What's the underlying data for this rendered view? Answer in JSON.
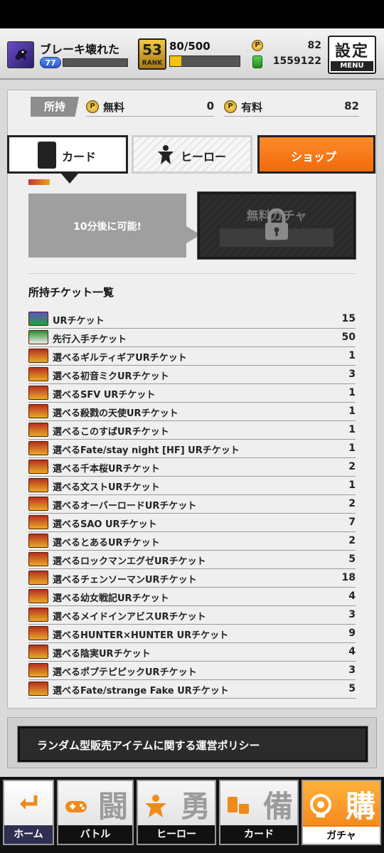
{
  "header": {
    "player_name": "ブレーキ壊れた",
    "level": "77",
    "rank": "53",
    "rank_label": "RANK",
    "stamina": "80/500",
    "stamina_ratio": 0.16,
    "paid_currency": "82",
    "money": "1559122",
    "settings_label": "設定",
    "menu_label": "MENU"
  },
  "owned": {
    "label": "所持",
    "free_label": "無料",
    "free_value": "0",
    "paid_label": "有料",
    "paid_value": "82"
  },
  "tabs": {
    "card": "カード",
    "hero": "ヒーロー",
    "shop": "ショップ"
  },
  "free_gacha": {
    "wait_text": "10分後に可能!",
    "title": "無料ガチャ",
    "button": "無料"
  },
  "tickets": {
    "title": "所持チケット一覧",
    "items": [
      {
        "name": "URチケット",
        "count": "15",
        "kind": "ur"
      },
      {
        "name": "先行入手チケット",
        "count": "50",
        "kind": "early"
      },
      {
        "name": "選べるギルティギアURチケット",
        "count": "1",
        "kind": "select"
      },
      {
        "name": "選べる初音ミクURチケット",
        "count": "3",
        "kind": "select"
      },
      {
        "name": "選べるSFV URチケット",
        "count": "1",
        "kind": "select"
      },
      {
        "name": "選べる殺戮の天使URチケット",
        "count": "1",
        "kind": "select"
      },
      {
        "name": "選べるこのすばURチケット",
        "count": "1",
        "kind": "select"
      },
      {
        "name": "選べるFate/stay night [HF] URチケット",
        "count": "1",
        "kind": "select"
      },
      {
        "name": "選べる千本桜URチケット",
        "count": "2",
        "kind": "select"
      },
      {
        "name": "選べる文ストURチケット",
        "count": "1",
        "kind": "select"
      },
      {
        "name": "選べるオーバーロードURチケット",
        "count": "2",
        "kind": "select"
      },
      {
        "name": "選べるSAO URチケット",
        "count": "7",
        "kind": "select"
      },
      {
        "name": "選べるとあるURチケット",
        "count": "2",
        "kind": "select"
      },
      {
        "name": "選べるロックマンエグゼURチケット",
        "count": "5",
        "kind": "select"
      },
      {
        "name": "選べるチェンソーマンURチケット",
        "count": "18",
        "kind": "select"
      },
      {
        "name": "選べる幼女戦記URチケット",
        "count": "4",
        "kind": "select"
      },
      {
        "name": "選べるメイドインアビスURチケット",
        "count": "3",
        "kind": "select"
      },
      {
        "name": "選べるHUNTER×HUNTER URチケット",
        "count": "9",
        "kind": "select"
      },
      {
        "name": "選べる陰実URチケット",
        "count": "4",
        "kind": "select"
      },
      {
        "name": "選べるポプテピピックURチケット",
        "count": "3",
        "kind": "select"
      },
      {
        "name": "選べるFate/strange Fake URチケット",
        "count": "5",
        "kind": "select"
      }
    ]
  },
  "policy": {
    "label": "ランダム型販売アイテムに関する運営ポリシー"
  },
  "nav": {
    "home": "ホーム",
    "battle": "バトル",
    "battle_kanji": "闘",
    "hero": "ヒーロー",
    "hero_kanji": "勇",
    "card": "カード",
    "card_kanji": "備",
    "gacha": "ガチャ",
    "gacha_kanji": "購"
  }
}
